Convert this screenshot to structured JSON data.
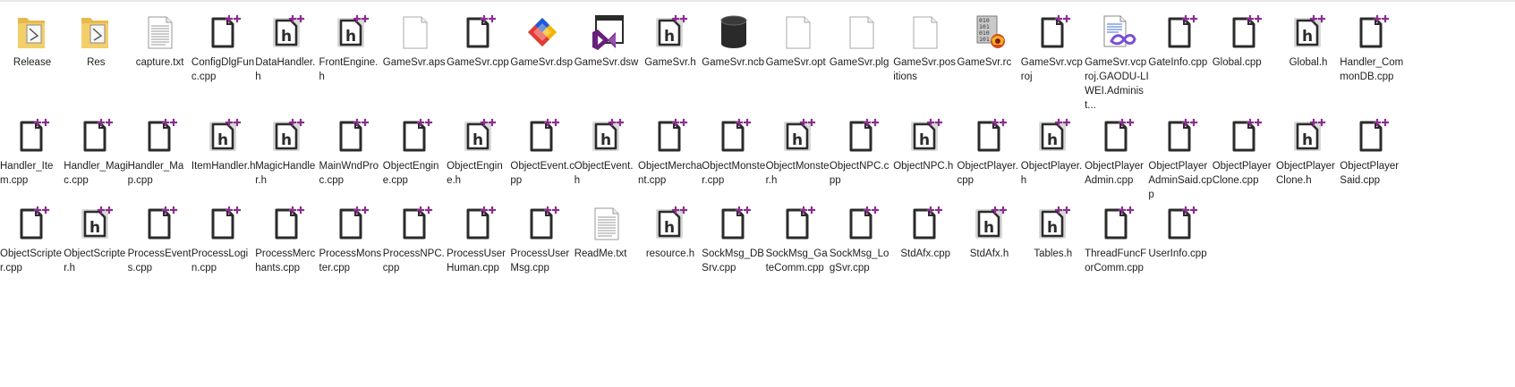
{
  "rows": [
    [
      {
        "label": "Release",
        "icon": "folder-icon"
      },
      {
        "label": "Res",
        "icon": "folder-icon"
      },
      {
        "label": "capture.txt",
        "icon": "text-document-icon"
      },
      {
        "label": "ConfigDlgFunc.cpp",
        "icon": "cpp-source-icon"
      },
      {
        "label": "DataHandler.h",
        "icon": "cpp-header-icon"
      },
      {
        "label": "FrontEngine.h",
        "icon": "cpp-header-icon"
      },
      {
        "label": "GameSvr.aps",
        "icon": "blank-file-icon"
      },
      {
        "label": "GameSvr.cpp",
        "icon": "cpp-source-icon"
      },
      {
        "label": "GameSvr.dsp",
        "icon": "visual-cpp-project-icon"
      },
      {
        "label": "GameSvr.dsw",
        "icon": "visual-studio-workspace-icon"
      },
      {
        "label": "GameSvr.h",
        "icon": "cpp-header-icon"
      },
      {
        "label": "GameSvr.ncb",
        "icon": "database-icon"
      },
      {
        "label": "GameSvr.opt",
        "icon": "blank-file-icon"
      },
      {
        "label": "GameSvr.plg",
        "icon": "blank-file-icon"
      },
      {
        "label": "GameSvr.positions",
        "icon": "blank-file-icon"
      },
      {
        "label": "GameSvr.rc",
        "icon": "resource-script-icon"
      },
      {
        "label": "GameSvr.vcproj",
        "icon": "cpp-source-icon"
      },
      {
        "label": "GameSvr.vcproj.GAODU-LIWEI.Administ...",
        "icon": "visual-studio-user-file-icon"
      },
      {
        "label": "GateInfo.cpp",
        "icon": "cpp-source-icon"
      },
      {
        "label": "Global.cpp",
        "icon": "cpp-source-icon"
      },
      {
        "label": "Global.h",
        "icon": "cpp-header-icon"
      },
      {
        "label": "Handler_CommonDB.cpp",
        "icon": "cpp-source-icon"
      }
    ],
    [
      {
        "label": "Handler_Item.cpp",
        "icon": "cpp-source-icon"
      },
      {
        "label": "Handler_Magic.cpp",
        "icon": "cpp-source-icon"
      },
      {
        "label": "Handler_Map.cpp",
        "icon": "cpp-source-icon"
      },
      {
        "label": "ItemHandler.h",
        "icon": "cpp-header-icon"
      },
      {
        "label": "MagicHandler.h",
        "icon": "cpp-header-icon"
      },
      {
        "label": "MainWndProc.cpp",
        "icon": "cpp-source-icon"
      },
      {
        "label": "ObjectEngine.cpp",
        "icon": "cpp-source-icon"
      },
      {
        "label": "ObjectEngine.h",
        "icon": "cpp-header-icon"
      },
      {
        "label": "ObjectEvent.cpp",
        "icon": "cpp-source-icon"
      },
      {
        "label": "ObjectEvent.h",
        "icon": "cpp-header-icon"
      },
      {
        "label": "ObjectMerchant.cpp",
        "icon": "cpp-source-icon"
      },
      {
        "label": "ObjectMonster.cpp",
        "icon": "cpp-source-icon"
      },
      {
        "label": "ObjectMonster.h",
        "icon": "cpp-header-icon"
      },
      {
        "label": "ObjectNPC.cpp",
        "icon": "cpp-source-icon"
      },
      {
        "label": "ObjectNPC.h",
        "icon": "cpp-header-icon"
      },
      {
        "label": "ObjectPlayer.cpp",
        "icon": "cpp-source-icon"
      },
      {
        "label": "ObjectPlayer.h",
        "icon": "cpp-header-icon"
      },
      {
        "label": "ObjectPlayerAdmin.cpp",
        "icon": "cpp-source-icon"
      },
      {
        "label": "ObjectPlayerAdminSaid.cpp",
        "icon": "cpp-source-icon"
      },
      {
        "label": "ObjectPlayerClone.cpp",
        "icon": "cpp-source-icon"
      },
      {
        "label": "ObjectPlayerClone.h",
        "icon": "cpp-header-icon"
      },
      {
        "label": "ObjectPlayerSaid.cpp",
        "icon": "cpp-source-icon"
      }
    ],
    [
      {
        "label": "ObjectScripter.cpp",
        "icon": "cpp-source-icon"
      },
      {
        "label": "ObjectScripter.h",
        "icon": "cpp-header-icon"
      },
      {
        "label": "ProcessEvents.cpp",
        "icon": "cpp-source-icon"
      },
      {
        "label": "ProcessLogin.cpp",
        "icon": "cpp-source-icon"
      },
      {
        "label": "ProcessMerchants.cpp",
        "icon": "cpp-source-icon"
      },
      {
        "label": "ProcessMonster.cpp",
        "icon": "cpp-source-icon"
      },
      {
        "label": "ProcessNPC.cpp",
        "icon": "cpp-source-icon"
      },
      {
        "label": "ProcessUserHuman.cpp",
        "icon": "cpp-source-icon"
      },
      {
        "label": "ProcessUserMsg.cpp",
        "icon": "cpp-source-icon"
      },
      {
        "label": "ReadMe.txt",
        "icon": "text-document-icon"
      },
      {
        "label": "resource.h",
        "icon": "cpp-header-icon"
      },
      {
        "label": "SockMsg_DBSrv.cpp",
        "icon": "cpp-source-icon"
      },
      {
        "label": "SockMsg_GateComm.cpp",
        "icon": "cpp-source-icon"
      },
      {
        "label": "SockMsg_LogSvr.cpp",
        "icon": "cpp-source-icon"
      },
      {
        "label": "StdAfx.cpp",
        "icon": "cpp-source-icon"
      },
      {
        "label": "StdAfx.h",
        "icon": "cpp-header-icon"
      },
      {
        "label": "Tables.h",
        "icon": "cpp-header-icon"
      },
      {
        "label": "ThreadFuncForComm.cpp",
        "icon": "cpp-source-icon"
      },
      {
        "label": "UserInfo.cpp",
        "icon": "cpp-source-icon"
      }
    ]
  ],
  "colors": {
    "plus_accent": "#8a2f8f",
    "folder_yellow": "#f3cf6a",
    "label_text": "#1e1e1e",
    "vs_purple": "#68217a"
  }
}
